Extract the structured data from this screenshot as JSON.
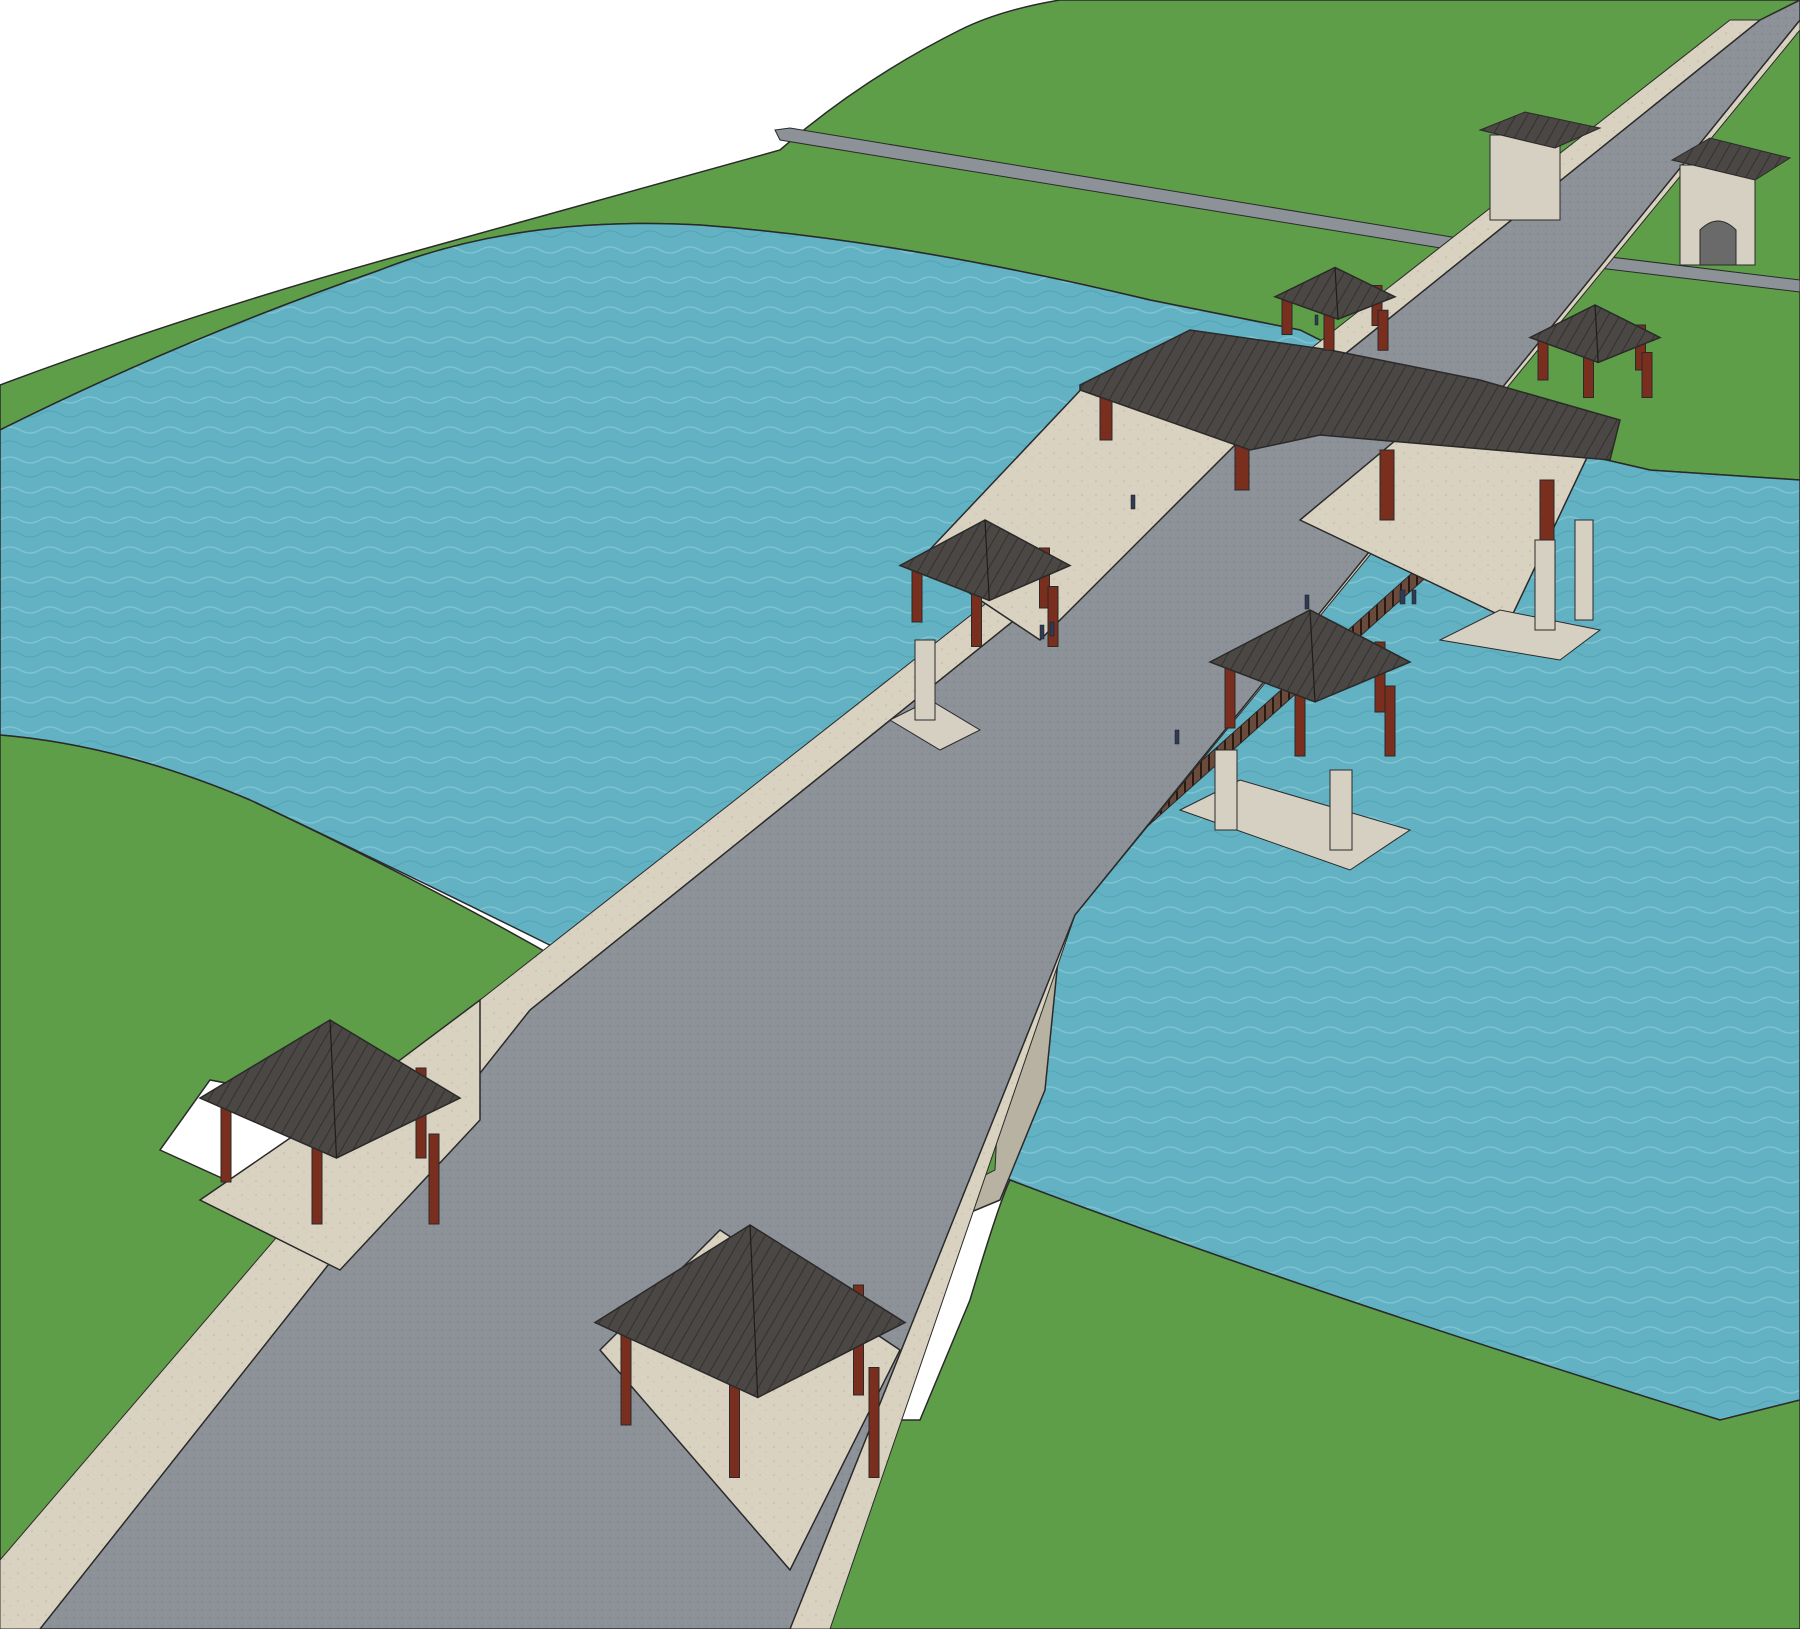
{
  "scene": {
    "subject": "bridge-3d-model",
    "view": "aerial-perspective",
    "pavilion_count": 8,
    "gate_tower_count": 2
  },
  "colors": {
    "background": "#ffffff",
    "grass": "#5f9e48",
    "grass_dark": "#4f8a3c",
    "water": "#62b2c3",
    "water_light": "#8ccbd7",
    "water_dark": "#4e9fb2",
    "road": "#8d9298",
    "road_dark": "#707780",
    "paving": "#d9d2c0",
    "paving_edge": "#bfb6a0",
    "stone": "#d6d0c2",
    "roof": "#4b4744",
    "roof_dark": "#34302d",
    "timber": "#7a2e1e",
    "railing": "#3a2a24",
    "wall_light": "#f2efe4",
    "outline": "#2a2a2a"
  }
}
